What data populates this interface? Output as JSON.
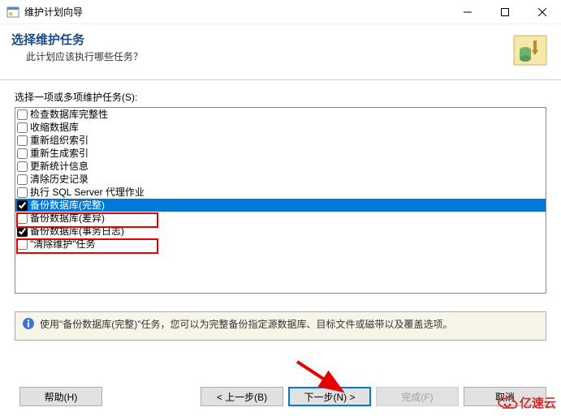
{
  "window": {
    "title": "维护计划向导",
    "minimize_tooltip": "Minimize",
    "maximize_tooltip": "Maximize",
    "close_tooltip": "Close"
  },
  "header": {
    "title": "选择维护任务",
    "subtitle": "此计划应该执行哪些任务？"
  },
  "list": {
    "label": "选择一项或多项维护任务(S):",
    "items": [
      {
        "label": "检查数据库完整性",
        "checked": false,
        "selected": false
      },
      {
        "label": "收缩数据库",
        "checked": false,
        "selected": false
      },
      {
        "label": "重新组织索引",
        "checked": false,
        "selected": false
      },
      {
        "label": "重新生成索引",
        "checked": false,
        "selected": false
      },
      {
        "label": "更新统计信息",
        "checked": false,
        "selected": false
      },
      {
        "label": "清除历史记录",
        "checked": false,
        "selected": false
      },
      {
        "label": "执行 SQL Server 代理作业",
        "checked": false,
        "selected": false
      },
      {
        "label": "备份数据库(完整)",
        "checked": true,
        "selected": true
      },
      {
        "label": "备份数据库(差异)",
        "checked": false,
        "selected": false
      },
      {
        "label": "备份数据库(事务日志)",
        "checked": true,
        "selected": false
      },
      {
        "label": "\"清除维护\"任务",
        "checked": false,
        "selected": false
      }
    ]
  },
  "info": {
    "text": "使用\"备份数据库(完整)\"任务，您可以为完整备份指定源数据库、目标文件或磁带以及覆盖选项。"
  },
  "buttons": {
    "help": "帮助(H)",
    "back": "< 上一步(B)",
    "next": "下一步(N) >",
    "finish": "完成(F)",
    "cancel": "取消"
  },
  "watermark": {
    "text": "亿速云"
  },
  "colors": {
    "selection": "#0078d7",
    "highlight": "#e60000",
    "info_bg": "#f6f5e8",
    "header_title": "#1a4a8a"
  }
}
